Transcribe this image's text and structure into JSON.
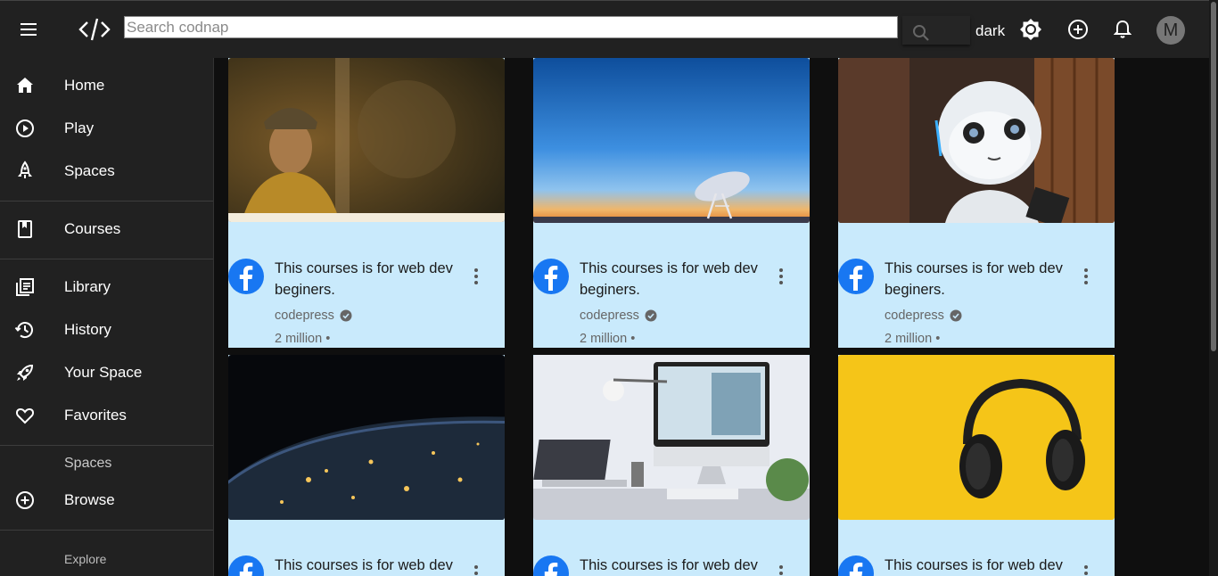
{
  "header": {
    "search_placeholder": "Search codnap",
    "theme_label": "dark",
    "avatar_letter": "M"
  },
  "sidebar": {
    "items": [
      {
        "label": "Home",
        "icon": "home-icon"
      },
      {
        "label": "Play",
        "icon": "play-circle-icon"
      },
      {
        "label": "Spaces",
        "icon": "rocket-icon"
      },
      {
        "label": "Courses",
        "icon": "book-icon"
      },
      {
        "label": "Library",
        "icon": "library-icon"
      },
      {
        "label": "History",
        "icon": "history-icon"
      },
      {
        "label": "Your Space",
        "icon": "rocket-launch-icon"
      },
      {
        "label": "Favorites",
        "icon": "heart-icon"
      },
      {
        "label": "Browse",
        "icon": "add-circle-icon"
      }
    ],
    "section_spaces": "Spaces",
    "section_explore": "Explore"
  },
  "cards": [
    {
      "title": "This courses is for web dev beginers.",
      "channel": "codepress",
      "views": "2 million •",
      "thumb": "cyclist-night"
    },
    {
      "title": "This courses is for web dev beginers.",
      "channel": "codepress",
      "views": "2 million •",
      "thumb": "satellite-dish-sunset"
    },
    {
      "title": "This courses is for web dev beginers.",
      "channel": "codepress",
      "views": "2 million •",
      "thumb": "white-robot"
    },
    {
      "title": "This courses is for web dev",
      "thumb": "earth-night-lights"
    },
    {
      "title": "This courses is for web dev",
      "thumb": "desk-imac-laptop"
    },
    {
      "title": "This courses is for web dev",
      "thumb": "headphones-yellow"
    }
  ],
  "colors": {
    "card_bg": "#c9eafc",
    "topbar_bg": "#212121",
    "page_bg": "#0f0f0f",
    "channel_icon": "#1877f2"
  }
}
